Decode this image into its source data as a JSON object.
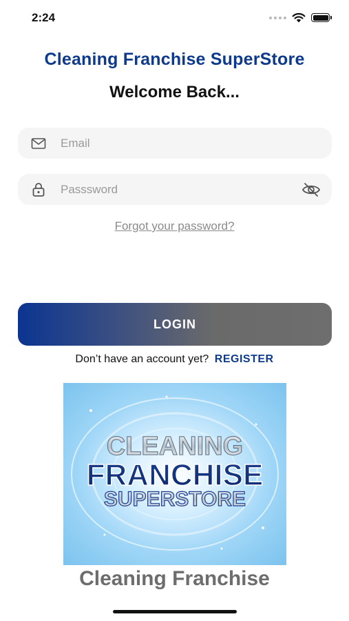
{
  "status_bar": {
    "time": "2:24"
  },
  "header": {
    "app_title": "Cleaning Franchise SuperStore",
    "welcome": "Welcome Back..."
  },
  "form": {
    "email_placeholder": "Email",
    "email_icon": "mail-icon",
    "password_placeholder": "Passsword",
    "password_icon": "lock-icon",
    "visibility_icon": "eye-off-icon",
    "forgot_label": "Forgot your password?",
    "login_label": "LOGIN",
    "no_account_text": "Don’t have an account yet?",
    "register_label": "REGISTER"
  },
  "logo": {
    "line1": "CLEANING",
    "line2": "FRANCHISE",
    "line3": "SUPERSTORE"
  },
  "footer": {
    "title": "Cleaning Franchise"
  },
  "colors": {
    "brand_blue": "#0e3a8c",
    "button_gradient_start": "#0b3591",
    "button_gradient_end": "#6e6e6e",
    "muted_gray": "#6d6d6d"
  }
}
